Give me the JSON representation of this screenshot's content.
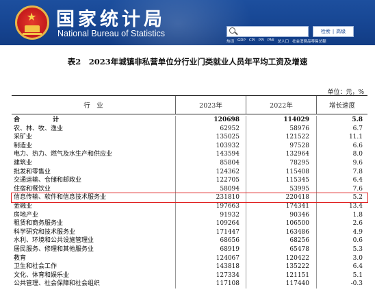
{
  "header": {
    "title_cn": "国家统计局",
    "title_en": "National Bureau of Statistics",
    "search_placeholder": "",
    "search_button": "检索",
    "advanced_button": "高级",
    "quick_links": [
      "热词",
      "GDP",
      "CPI",
      "PPI",
      "PMI",
      "总人口",
      "社会消费品零售总额"
    ]
  },
  "table": {
    "title": "表2　2023年城镇非私营单位分行业门类就业人员年平均工资及增速",
    "unit": "单位：元，%",
    "columns": [
      "行　业",
      "2023年",
      "2022年",
      "增长速度"
    ],
    "rows": [
      {
        "industry": "合　　计",
        "y2023": "120698",
        "y2022": "114029",
        "growth": "5.8",
        "total": true
      },
      {
        "industry": "农、林、牧、渔业",
        "y2023": "62952",
        "y2022": "58976",
        "growth": "6.7"
      },
      {
        "industry": "采矿业",
        "y2023": "135025",
        "y2022": "121522",
        "growth": "11.1"
      },
      {
        "industry": "制造业",
        "y2023": "103932",
        "y2022": "97528",
        "growth": "6.6"
      },
      {
        "industry": "电力、热力、燃气及水生产和供应业",
        "y2023": "143594",
        "y2022": "132964",
        "growth": "8.0"
      },
      {
        "industry": "建筑业",
        "y2023": "85804",
        "y2022": "78295",
        "growth": "9.6"
      },
      {
        "industry": "批发和零售业",
        "y2023": "124362",
        "y2022": "115408",
        "growth": "7.8"
      },
      {
        "industry": "交通运输、仓储和邮政业",
        "y2023": "122705",
        "y2022": "115345",
        "growth": "6.4"
      },
      {
        "industry": "住宿和餐饮业",
        "y2023": "58094",
        "y2022": "53995",
        "growth": "7.6"
      },
      {
        "industry": "信息传输、软件和信息技术服务业",
        "y2023": "231810",
        "y2022": "220418",
        "growth": "5.2",
        "highlight": true
      },
      {
        "industry": "金融业",
        "y2023": "197663",
        "y2022": "174341",
        "growth": "13.4"
      },
      {
        "industry": "房地产业",
        "y2023": "91932",
        "y2022": "90346",
        "growth": "1.8"
      },
      {
        "industry": "租赁和商务服务业",
        "y2023": "109264",
        "y2022": "106500",
        "growth": "2.6"
      },
      {
        "industry": "科学研究和技术服务业",
        "y2023": "171447",
        "y2022": "163486",
        "growth": "4.9"
      },
      {
        "industry": "水利、环境和公共设施管理业",
        "y2023": "68656",
        "y2022": "68256",
        "growth": "0.6"
      },
      {
        "industry": "居民服务、修理和其他服务业",
        "y2023": "68919",
        "y2022": "65478",
        "growth": "5.3"
      },
      {
        "industry": "教育",
        "y2023": "124067",
        "y2022": "120422",
        "growth": "3.0"
      },
      {
        "industry": "卫生和社会工作",
        "y2023": "143818",
        "y2022": "135222",
        "growth": "6.4"
      },
      {
        "industry": "文化、体育和娱乐业",
        "y2023": "127334",
        "y2022": "121151",
        "growth": "5.1"
      },
      {
        "industry": "公共管理、社会保障和社会组织",
        "y2023": "117108",
        "y2022": "117440",
        "growth": "-0.3"
      }
    ]
  },
  "colors": {
    "banner": "#164592",
    "highlight_box": "#e02020"
  }
}
